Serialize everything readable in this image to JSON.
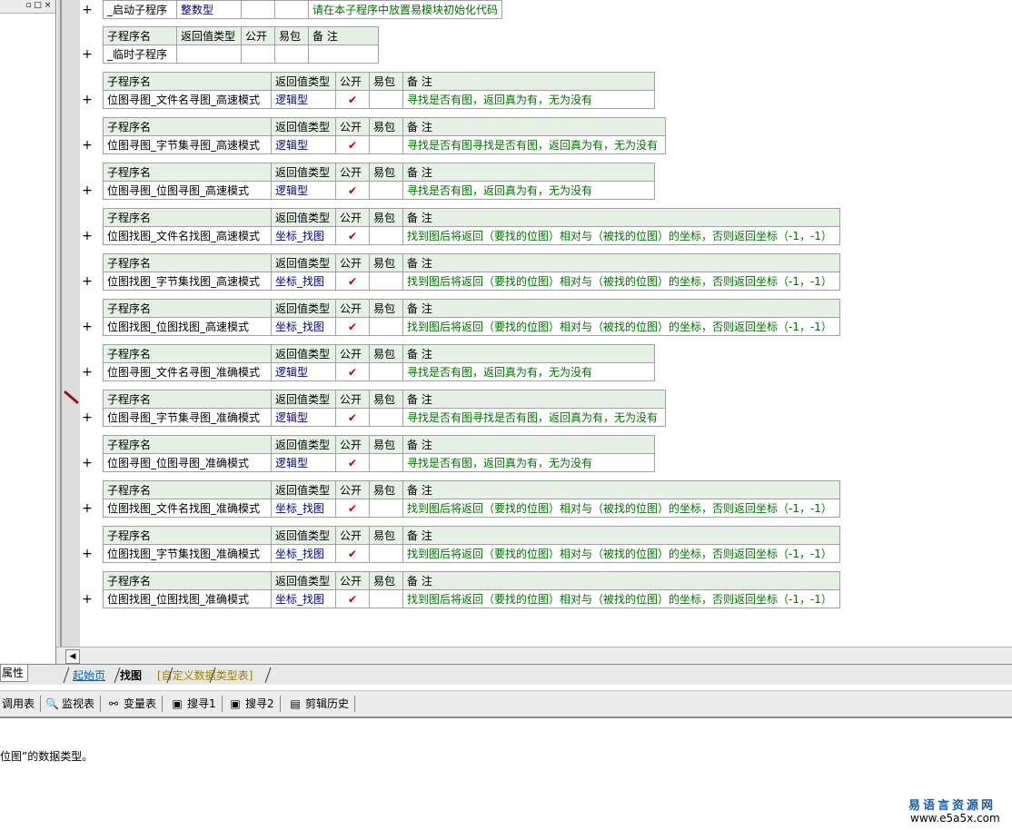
{
  "headers": {
    "name": "子程序名",
    "ret": "返回值类型",
    "pub": "公开",
    "easy": "易包",
    "note": "备 注"
  },
  "first_row": {
    "name": "_启动子程序",
    "type": "整数型",
    "note": "请在本子程序中放置易模块初始化代码"
  },
  "temp_sub": {
    "name": "_临时子程序"
  },
  "check_mark": "✔",
  "plus": "+",
  "subs": [
    {
      "name": "位图寻图_文件名寻图_高速模式",
      "type": "逻辑型",
      "note": "寻找是否有图，返回真为有，无为没有"
    },
    {
      "name": "位图寻图_字节集寻图_高速模式",
      "type": "逻辑型",
      "note": "寻找是否有图寻找是否有图，返回真为有，无为没有"
    },
    {
      "name": "位图寻图_位图寻图_高速模式",
      "type": "逻辑型",
      "note": "寻找是否有图，返回真为有，无为没有"
    },
    {
      "name": "位图找图_文件名找图_高速模式",
      "type": "坐标_找图",
      "note": "找到图后将返回（要找的位图）相对与（被找的位图）的坐标，否则返回坐标（-1，-1）"
    },
    {
      "name": "位图找图_字节集找图_高速模式",
      "type": "坐标_找图",
      "note": "找到图后将返回（要找的位图）相对与（被找的位图）的坐标，否则返回坐标（-1，-1）"
    },
    {
      "name": "位图找图_位图找图_高速模式",
      "type": "坐标_找图",
      "note": "找到图后将返回（要找的位图）相对与（被找的位图）的坐标，否则返回坐标（-1，-1）"
    },
    {
      "name": "位图寻图_文件名寻图_准确模式",
      "type": "逻辑型",
      "note": "寻找是否有图，返回真为有，无为没有"
    },
    {
      "name": "位图寻图_字节集寻图_准确模式",
      "type": "逻辑型",
      "note": "寻找是否有图寻找是否有图，返回真为有，无为没有"
    },
    {
      "name": "位图寻图_位图寻图_准确模式",
      "type": "逻辑型",
      "note": "寻找是否有图，返回真为有，无为没有"
    },
    {
      "name": "位图找图_文件名找图_准确模式",
      "type": "坐标_找图",
      "note": "找到图后将返回（要找的位图）相对与（被找的位图）的坐标，否则返回坐标（-1，-1）"
    },
    {
      "name": "位图找图_字节集找图_准确模式",
      "type": "坐标_找图",
      "note": "找到图后将返回（要找的位图）相对与（被找的位图）的坐标，否则返回坐标（-1，-1）"
    },
    {
      "name": "位图找图_位图找图_准确模式",
      "type": "坐标_找图",
      "note": "找到图后将返回（要找的位图）相对与（被找的位图）的坐标，否则返回坐标（-1，-1）"
    }
  ],
  "left_panel": {
    "restore_icon": "▫",
    "max_icon": "□",
    "close_icon": "×"
  },
  "scroll": {
    "left_arrow": "◀"
  },
  "tabs": {
    "properties": "属性",
    "start_page": "起始页",
    "find_image": "找图",
    "custom_types": "[自定义数据类型表]"
  },
  "bottom_tabs": [
    {
      "icon": "",
      "label": "调用表"
    },
    {
      "icon": "🔍",
      "label": "监视表"
    },
    {
      "icon": "⚯",
      "label": "变量表"
    },
    {
      "icon": "▣",
      "label": "搜寻1"
    },
    {
      "icon": "▣",
      "label": "搜寻2"
    },
    {
      "icon": "▤",
      "label": "剪辑历史"
    }
  ],
  "output": {
    "text": "位图”的数据类型。"
  },
  "watermark": {
    "title": "易语言资源网",
    "url": "www.e5a5x.com"
  },
  "colors": {
    "header_bg": "#e6f0e6",
    "type_color": "#000080",
    "note_color": "#007000",
    "check_color": "#c00000"
  }
}
